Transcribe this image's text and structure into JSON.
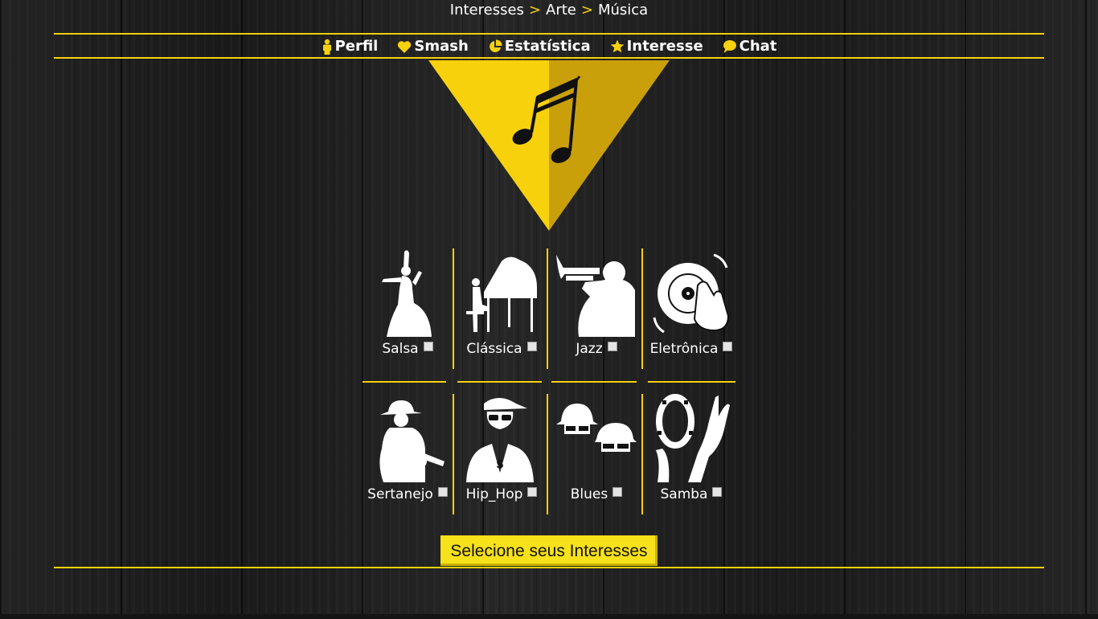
{
  "breadcrumb": {
    "items": [
      "Interesses",
      "Arte",
      "Música"
    ],
    "separator": ">"
  },
  "nav": [
    {
      "label": "Perfil",
      "icon": "person-icon"
    },
    {
      "label": "Smash",
      "icon": "heart-icon"
    },
    {
      "label": "Estatística",
      "icon": "pie-chart-icon"
    },
    {
      "label": "Interesse",
      "icon": "star-icon"
    },
    {
      "label": "Chat",
      "icon": "chat-bubble-icon"
    }
  ],
  "hero": {
    "icon": "music-notes-icon"
  },
  "genres": [
    {
      "label": "Salsa",
      "icon": "salsa-dancer-icon",
      "checked": false
    },
    {
      "label": "Clássica",
      "icon": "pianist-icon",
      "checked": false
    },
    {
      "label": "Jazz",
      "icon": "trumpet-player-icon",
      "checked": false
    },
    {
      "label": "Eletrônica",
      "icon": "dj-turntable-icon",
      "checked": false
    },
    {
      "label": "Sertanejo",
      "icon": "cowboy-guitarist-icon",
      "checked": false
    },
    {
      "label": "Hip_Hop",
      "icon": "rapper-icon",
      "checked": false
    },
    {
      "label": "Blues",
      "icon": "blues-brothers-icon",
      "checked": false
    },
    {
      "label": "Samba",
      "icon": "tambourine-icon",
      "checked": false
    }
  ],
  "submit_label": "Selecione seus Interesses",
  "colors": {
    "accent": "#f7d10c",
    "accent_dark": "#c9a00a",
    "text": "#ffffff"
  }
}
